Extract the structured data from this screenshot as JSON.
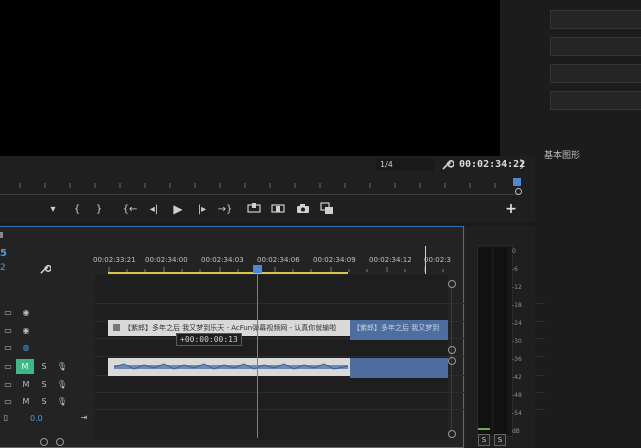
{
  "program_monitor": {
    "resolution": "1/4",
    "timecode": "00:02:34:22",
    "bracket": "}"
  },
  "transport": {
    "marker": "▾",
    "in": "{",
    "out": "}",
    "go_in": "{←",
    "step_back": "◂|",
    "play": "▶",
    "step_fwd": "|▸",
    "go_out": "→}",
    "add": "+"
  },
  "right_panel": {
    "title": "基本图形"
  },
  "timeline": {
    "sequence_timecode": "5",
    "ruler_labels": [
      "00:02:33:21",
      "00:02:34:00",
      "00:02:34:03",
      "00:02:34:06",
      "00:02:34:09",
      "00:02:34:12",
      "00:02:3"
    ],
    "clip_title": "【紫郎】多年之后 我又梦到乐天 - AcFun弹幕视频网 - 认真你就输啦",
    "clip_title_blue": "【紫郎】多年之后 我又梦到",
    "tooltip": "+00:00:00:13",
    "track_m": "M",
    "track_s": "S",
    "master_volume": "0.0"
  },
  "meters": {
    "labels": [
      "0",
      "-6",
      "-12",
      "-18",
      "-24",
      "-30",
      "-36",
      "-42",
      "-48",
      "-54",
      "dB"
    ],
    "solo": [
      "S",
      "S"
    ]
  },
  "colors": {
    "accent_blue": "#4a8ad4",
    "mute_green": "#3fb58a",
    "work_area": "#d8c64a",
    "clip_blue": "#4d6e9e"
  }
}
